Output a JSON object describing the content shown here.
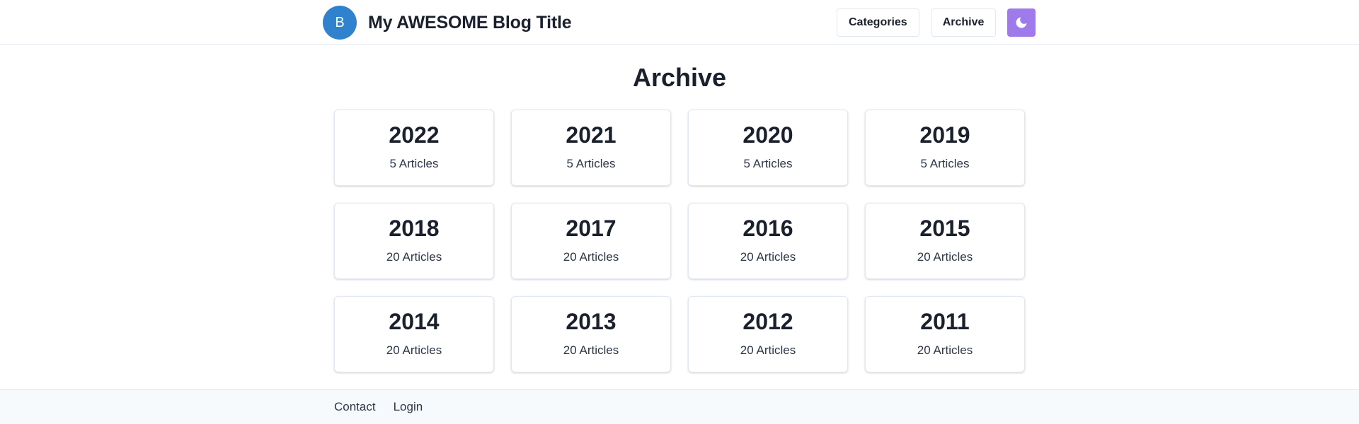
{
  "header": {
    "avatar_initial": "B",
    "site_title": "My AWESOME Blog Title",
    "nav": {
      "categories_label": "Categories",
      "archive_label": "Archive"
    },
    "theme_toggle_icon": "moon-icon",
    "accent_color": "#9f7aea",
    "avatar_color": "#3182ce"
  },
  "main": {
    "page_title": "Archive",
    "years": [
      {
        "year": "2022",
        "count": "5 Articles"
      },
      {
        "year": "2021",
        "count": "5 Articles"
      },
      {
        "year": "2020",
        "count": "5 Articles"
      },
      {
        "year": "2019",
        "count": "5 Articles"
      },
      {
        "year": "2018",
        "count": "20 Articles"
      },
      {
        "year": "2017",
        "count": "20 Articles"
      },
      {
        "year": "2016",
        "count": "20 Articles"
      },
      {
        "year": "2015",
        "count": "20 Articles"
      },
      {
        "year": "2014",
        "count": "20 Articles"
      },
      {
        "year": "2013",
        "count": "20 Articles"
      },
      {
        "year": "2012",
        "count": "20 Articles"
      },
      {
        "year": "2011",
        "count": "20 Articles"
      }
    ]
  },
  "footer": {
    "links": [
      "Contact",
      "Login"
    ]
  }
}
